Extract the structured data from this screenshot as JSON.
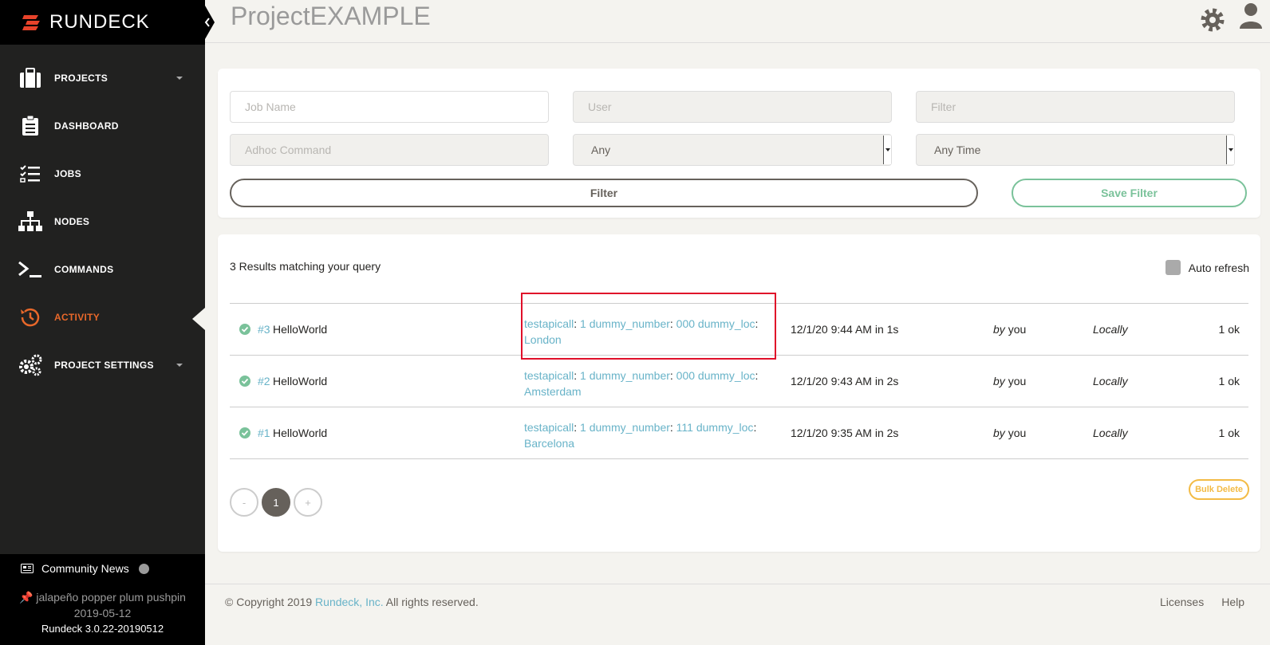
{
  "brand": {
    "name": "RUNDECK"
  },
  "header": {
    "title": "ProjectEXAMPLE"
  },
  "sidebar": {
    "items": [
      {
        "label": "PROJECTS",
        "icon": "briefcase-icon"
      },
      {
        "label": "DASHBOARD",
        "icon": "clipboard-icon"
      },
      {
        "label": "JOBS",
        "icon": "tasks-icon"
      },
      {
        "label": "NODES",
        "icon": "sitemap-icon"
      },
      {
        "label": "COMMANDS",
        "icon": "terminal-icon"
      },
      {
        "label": "ACTIVITY",
        "icon": "history-icon"
      },
      {
        "label": "PROJECT SETTINGS",
        "icon": "gears-icon"
      }
    ],
    "community_news": "Community News",
    "release_name": "jalapeño popper plum pushpin",
    "release_date": "2019-05-12",
    "version": "Rundeck 3.0.22-20190512"
  },
  "filter": {
    "job_name_placeholder": "Job Name",
    "user_placeholder": "User",
    "filter_placeholder": "Filter",
    "adhoc_placeholder": "Adhoc Command",
    "status_selected": "Any",
    "time_selected": "Any Time",
    "filter_button": "Filter",
    "save_filter_button": "Save Filter"
  },
  "results": {
    "count_text": "3 Results matching your query",
    "auto_refresh_label": "Auto refresh",
    "rows": [
      {
        "id": "#3",
        "job": "HelloWorld",
        "arg1_key": "testapicall",
        "arg1_val": "1",
        "arg2_key": "dummy_number",
        "arg2_val": "000",
        "arg3_key": "dummy_loc",
        "arg3_val": "London",
        "date": "12/1/20 9:44 AM in 1s",
        "by_label": "by",
        "user": "you",
        "node": "Locally",
        "outcome": "1 ok"
      },
      {
        "id": "#2",
        "job": "HelloWorld",
        "arg1_key": "testapicall",
        "arg1_val": "1",
        "arg2_key": "dummy_number",
        "arg2_val": "000",
        "arg3_key": "dummy_loc",
        "arg3_val": "Amsterdam",
        "date": "12/1/20 9:43 AM in 2s",
        "by_label": "by",
        "user": "you",
        "node": "Locally",
        "outcome": "1 ok"
      },
      {
        "id": "#1",
        "job": "HelloWorld",
        "arg1_key": "testapicall",
        "arg1_val": "1",
        "arg2_key": "dummy_number",
        "arg2_val": "111",
        "arg3_key": "dummy_loc",
        "arg3_val": "Barcelona",
        "date": "12/1/20 9:35 AM in 2s",
        "by_label": "by",
        "user": "you",
        "node": "Locally",
        "outcome": "1 ok"
      }
    ],
    "pager": {
      "prev": "-",
      "current": "1",
      "next": "+"
    },
    "bulk_delete": "Bulk Delete"
  },
  "footer": {
    "copyright_prefix": "© Copyright 2019",
    "company": "Rundeck, Inc.",
    "copyright_suffix": "All rights reserved.",
    "licenses": "Licenses",
    "help": "Help"
  },
  "colors": {
    "accent": "#e8682a",
    "link": "#68b3c8",
    "success": "#7ac29a",
    "warning": "#f3bb45",
    "highlight": "#e0102a"
  }
}
